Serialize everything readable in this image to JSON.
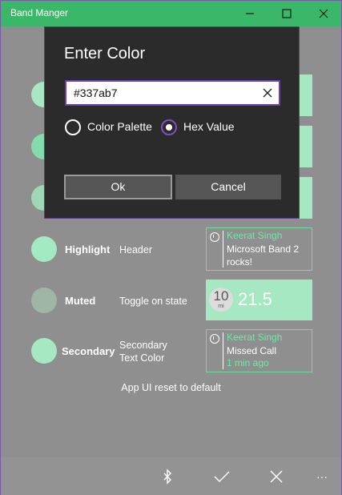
{
  "window": {
    "title": "Band Manger"
  },
  "colors": {
    "accent": "#3ab769",
    "tile_text": "#6fe8a7",
    "tile_fill": "#a5e8c1",
    "dialog_bg": "#2b2b2b",
    "focus": "#6a3fb0"
  },
  "rows": [
    {
      "label": "Highlight",
      "desc": "Header",
      "circle_color": "#a3e9c2"
    },
    {
      "label": "Muted",
      "desc": "Toggle on state",
      "circle_color": "#9fb5a6"
    },
    {
      "label": "Secondary",
      "desc": "Secondary\nText Color",
      "circle_color": "#a5e8c1"
    }
  ],
  "tiles": {
    "highlight": {
      "name": "Keerat Singh",
      "message": "Microsoft Band 2\nrocks!"
    },
    "muted": {
      "circle_value": "10",
      "circle_unit": "mi",
      "value": "21.5"
    },
    "secondary": {
      "name": "Keerat Singh",
      "message": "Missed Call",
      "time": "1 min ago"
    }
  },
  "footer": {
    "status": "App UI reset to default"
  },
  "appbar": {
    "icons": [
      "bluetooth-icon",
      "check-icon",
      "close-icon",
      "more-icon"
    ],
    "more_glyph": "···"
  },
  "dialog": {
    "title": "Enter Color",
    "input_value": "#337ab7",
    "options": [
      {
        "label": "Color Palette",
        "selected": false
      },
      {
        "label": "Hex Value",
        "selected": true
      }
    ],
    "ok_label": "Ok",
    "cancel_label": "Cancel"
  }
}
